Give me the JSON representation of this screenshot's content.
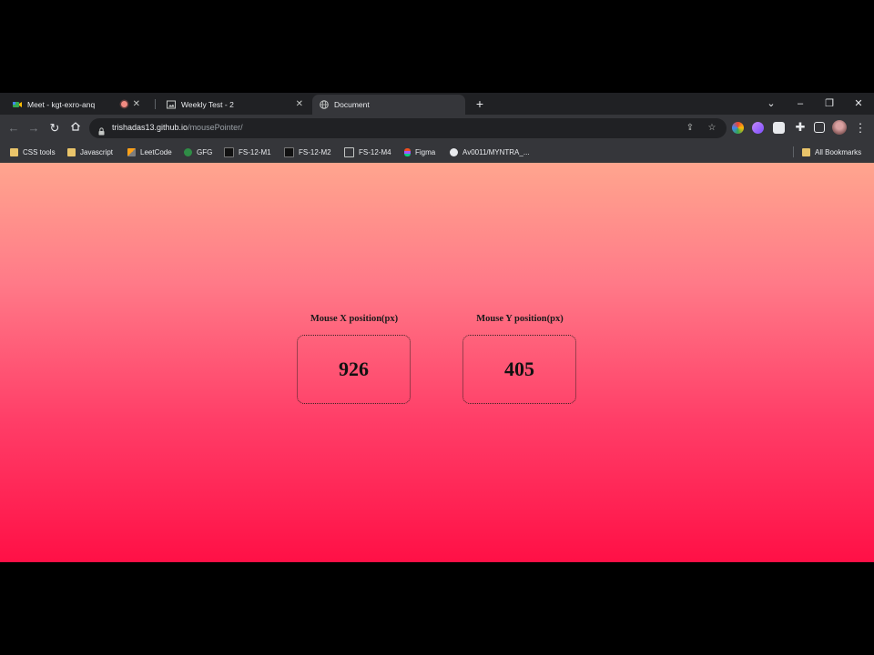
{
  "tabs": [
    {
      "title": "Meet - kgt-exro-anq",
      "active": false
    },
    {
      "title": "Weekly Test - 2",
      "active": false
    },
    {
      "title": "Document",
      "active": true
    }
  ],
  "toolbar": {
    "url_domain": "trishadas13.github.io",
    "url_path": "/mousePointer/"
  },
  "bookmarks": [
    {
      "label": "CSS tools",
      "icon": "folder-icon"
    },
    {
      "label": "Javascript",
      "icon": "folder-icon"
    },
    {
      "label": "LeetCode",
      "icon": "leetcode-icon"
    },
    {
      "label": "GFG",
      "icon": "gfg-icon"
    },
    {
      "label": "FS-12-M1",
      "icon": "site-icon"
    },
    {
      "label": "FS-12-M2",
      "icon": "site-icon"
    },
    {
      "label": "FS-12-M4",
      "icon": "image-icon"
    },
    {
      "label": "Figma",
      "icon": "figma-icon"
    },
    {
      "label": "Av0011/MYNTRA_...",
      "icon": "github-icon"
    }
  ],
  "all_bookmarks_label": "All Bookmarks",
  "main": {
    "x_label": "Mouse X position(px)",
    "x_value": "926",
    "y_label": "Mouse Y position(px)",
    "y_value": "405"
  },
  "colors": {
    "gradient_top": "#ffa58e",
    "gradient_bottom": "#ff1046",
    "chrome_dark": "#202124",
    "chrome_toolbar": "#35363a"
  }
}
